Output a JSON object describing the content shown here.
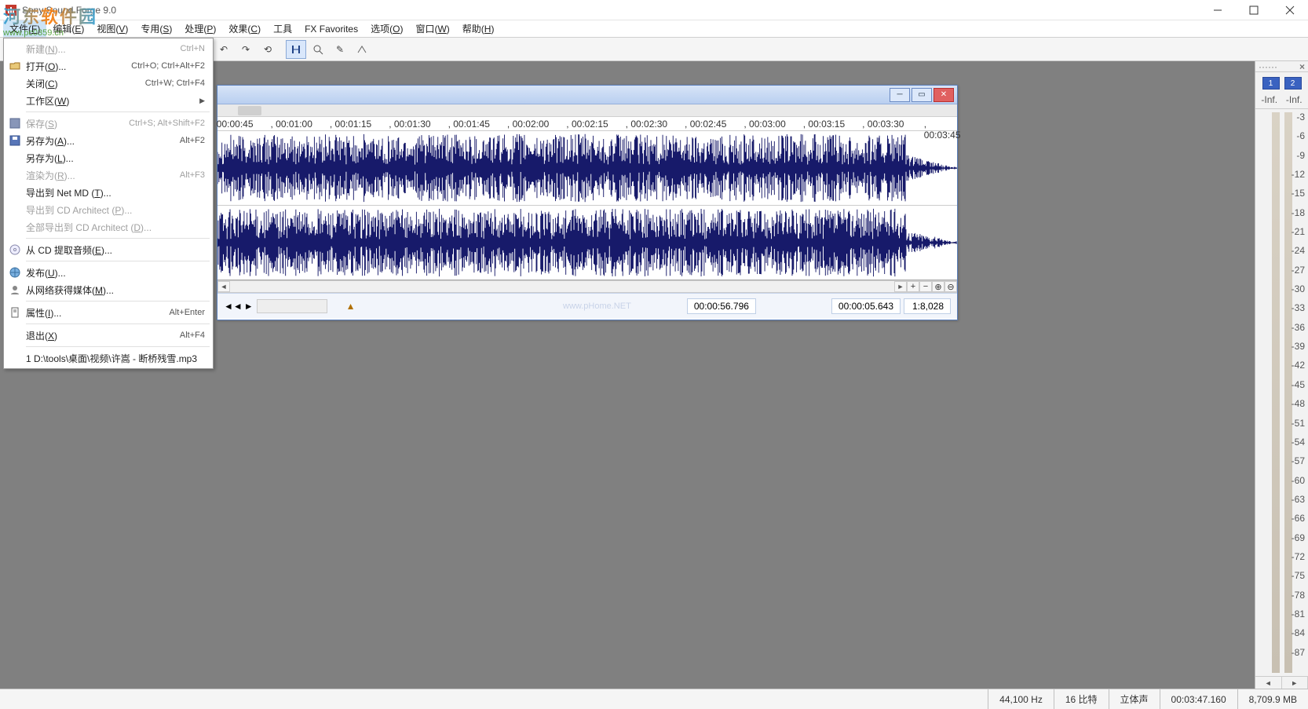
{
  "watermark": {
    "big": "河东软件园",
    "url": "www.pc0359.cn"
  },
  "titlebar": {
    "title": "Sony Sound Forge 9.0"
  },
  "menubar": {
    "items": [
      {
        "label": "文件(F)"
      },
      {
        "label": "编辑(E)"
      },
      {
        "label": "视图(V)"
      },
      {
        "label": "专用(S)"
      },
      {
        "label": "处理(P)"
      },
      {
        "label": "效果(C)"
      },
      {
        "label": "工具"
      },
      {
        "label": "FX Favorites"
      },
      {
        "label": "选项(O)"
      },
      {
        "label": "窗口(W)"
      },
      {
        "label": "帮助(H)"
      }
    ]
  },
  "dropdown": {
    "items": [
      {
        "label": "新建(N)...",
        "shortcut": "Ctrl+N",
        "disabled": true
      },
      {
        "label": "打开(O)...",
        "shortcut": "Ctrl+O; Ctrl+Alt+F2",
        "icon": "folder"
      },
      {
        "label": "关闭(C)",
        "shortcut": "Ctrl+W; Ctrl+F4"
      },
      {
        "label": "工作区(W)",
        "submenu": true
      },
      {
        "sep": true
      },
      {
        "label": "保存(S)",
        "shortcut": "Ctrl+S; Alt+Shift+F2",
        "icon": "disk",
        "disabled": true
      },
      {
        "label": "另存为(A)...",
        "shortcut": "Alt+F2",
        "icon": "disk2"
      },
      {
        "label": "另存为(L)..."
      },
      {
        "label": "渲染为(R)...",
        "shortcut": "Alt+F3",
        "disabled": true
      },
      {
        "label": "导出到 Net MD (T)..."
      },
      {
        "label": "导出到 CD Architect (P)...",
        "disabled": true
      },
      {
        "label": "全部导出到 CD Architect (D)...",
        "disabled": true
      },
      {
        "sep": true
      },
      {
        "label": "从 CD 提取音频(E)...",
        "icon": "cd"
      },
      {
        "sep": true
      },
      {
        "label": "发布(U)...",
        "icon": "globe"
      },
      {
        "label": "从网络获得媒体(M)...",
        "icon": "user"
      },
      {
        "sep": true
      },
      {
        "label": "属性(I)...",
        "shortcut": "Alt+Enter",
        "icon": "sheet"
      },
      {
        "sep": true
      },
      {
        "label": "退出(X)",
        "shortcut": "Alt+F4"
      },
      {
        "sep": true
      },
      {
        "label": "1 D:\\tools\\桌面\\视频\\许嵩 - 断桥残雪.mp3"
      }
    ]
  },
  "ruler": {
    "ticks": [
      "00:00:45",
      "00:01:00",
      "00:01:15",
      "00:01:30",
      "00:01:45",
      "00:02:00",
      "00:02:15",
      "00:02:30",
      "00:02:45",
      "00:03:00",
      "00:03:15",
      "00:03:30",
      "00:03:45"
    ]
  },
  "aw_status": {
    "time1": "00:00:56.796",
    "time2": "00:00:05.643",
    "ratio": "1:8,028",
    "marker": "▲",
    "watermark": "www.pHome.NET"
  },
  "meters": {
    "hdr_dots": "······",
    "close": "×",
    "ch": [
      "1",
      "2"
    ],
    "inf": [
      "-Inf.",
      "-Inf."
    ],
    "ticks": [
      "-3",
      "-6",
      "-9",
      "-12",
      "-15",
      "-18",
      "-21",
      "-24",
      "-27",
      "-30",
      "-33",
      "-36",
      "-39",
      "-42",
      "-45",
      "-48",
      "-51",
      "-54",
      "-57",
      "-60",
      "-63",
      "-66",
      "-69",
      "-72",
      "-75",
      "-78",
      "-81",
      "-84",
      "-87"
    ],
    "sb": [
      "◄",
      "►"
    ]
  },
  "status": {
    "hz": "44,100 Hz",
    "bit": "16 比特",
    "ch": "立体声",
    "dur": "00:03:47.160",
    "mem": "8,709.9 MB"
  }
}
